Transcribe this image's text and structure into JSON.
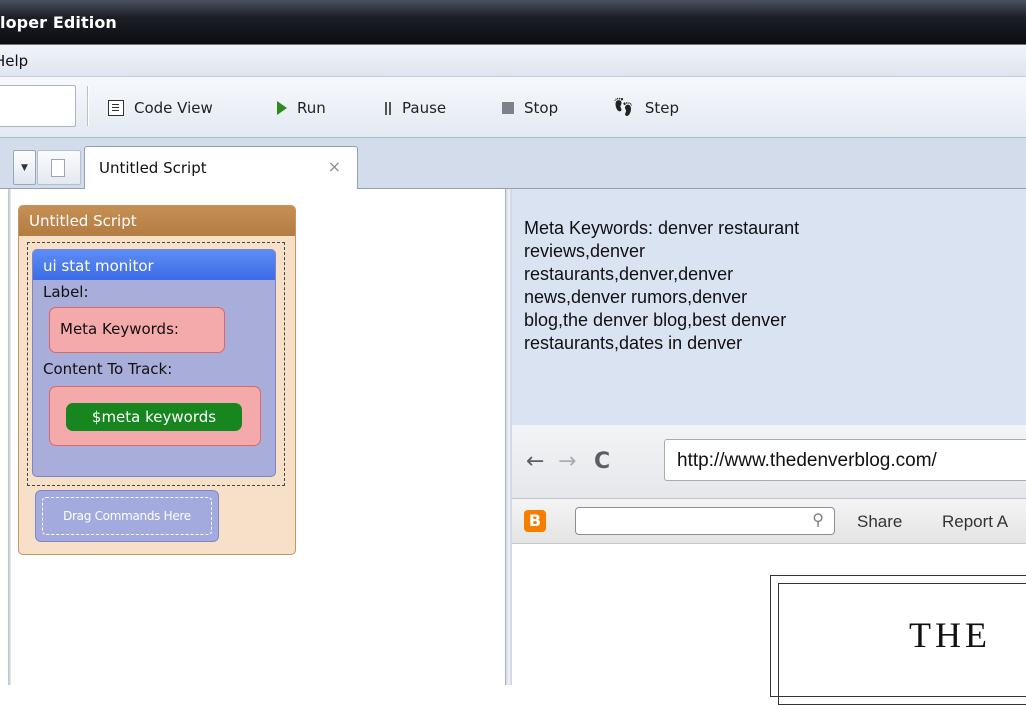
{
  "window": {
    "title": "loper Edition"
  },
  "menubar": {
    "help": "Help"
  },
  "toolbar": {
    "code_view": "Code View",
    "run": "Run",
    "pause": "Pause",
    "stop": "Stop",
    "step": "Step"
  },
  "tabs": [
    {
      "label": "Untitled Script",
      "close": "×"
    }
  ],
  "script": {
    "title": "Untitled Script",
    "monitor": {
      "title": "ui stat monitor",
      "label_caption": "Label:",
      "label_value": "Meta Keywords:",
      "content_caption": "Content To Track:",
      "content_value": "$meta keywords"
    },
    "drag_placeholder": "Drag Commands Here"
  },
  "stats": {
    "lines": [
      "Meta Keywords: denver restaurant",
      "reviews,denver",
      "restaurants,denver,denver",
      "news,denver rumors,denver",
      "blog,the denver blog,best denver",
      "restaurants,dates in denver"
    ]
  },
  "browser": {
    "back": "←",
    "forward": "→",
    "reload": "C",
    "url": "http://www.thedenverblog.com/"
  },
  "blogger_bar": {
    "logo": "B",
    "search_icon": "search-icon",
    "share": "Share",
    "report": "Report A"
  },
  "blog": {
    "masthead": "THE"
  }
}
